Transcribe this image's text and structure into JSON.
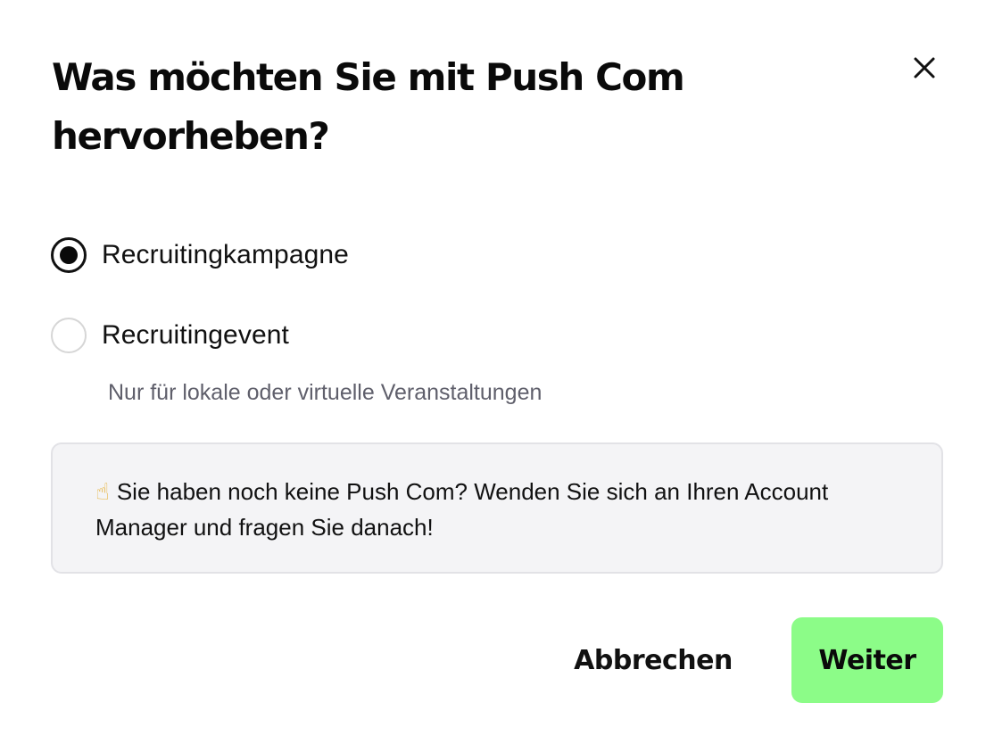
{
  "dialog": {
    "title": "Was möchten Sie mit Push Com hervorheben?",
    "close_icon": "close-icon"
  },
  "options": [
    {
      "label": "Recruitingkampagne",
      "selected": true
    },
    {
      "label": "Recruitingevent",
      "selected": false,
      "hint": "Nur für lokale oder virtuelle Veranstaltungen"
    }
  ],
  "info": {
    "emoji": "☝",
    "icon": "pointing-finger-icon",
    "text": "Sie haben noch keine Push Com? Wenden Sie sich an Ihren Account Manager und fragen Sie danach!"
  },
  "actions": {
    "cancel_label": "Abbrechen",
    "next_label": "Weiter"
  },
  "colors": {
    "primary_button": "#8cfc88",
    "info_background": "#f4f4f6",
    "hint_text": "#5f5f6b"
  }
}
